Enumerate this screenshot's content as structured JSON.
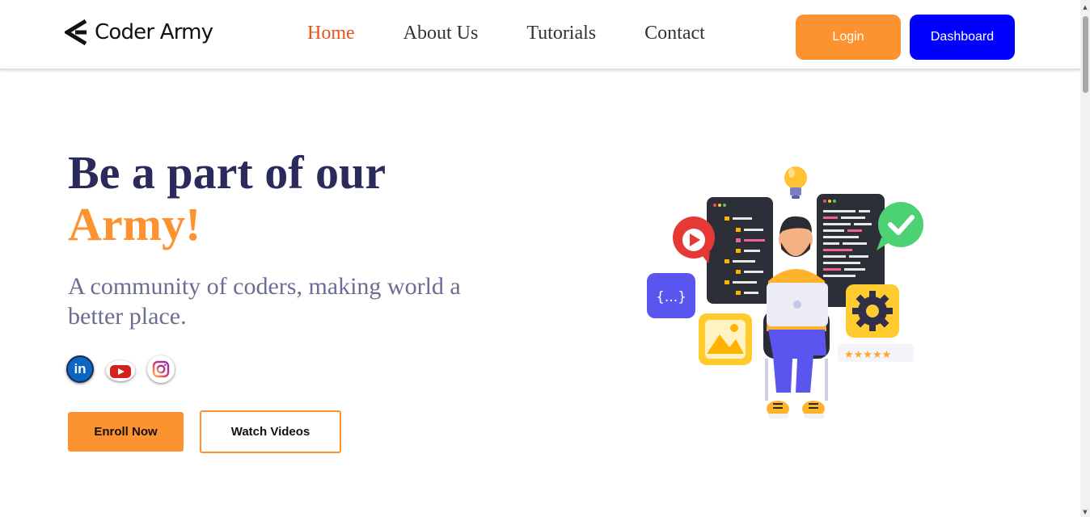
{
  "brand": {
    "name": "Coder Army",
    "icon": "coder-army-logo-icon"
  },
  "nav": {
    "items": [
      {
        "label": "Home",
        "active": true
      },
      {
        "label": "About Us",
        "active": false
      },
      {
        "label": "Tutorials",
        "active": false
      },
      {
        "label": "Contact",
        "active": false
      }
    ],
    "login_label": "Login",
    "dashboard_label": "Dashboard"
  },
  "hero": {
    "title_line1": "Be a part of our",
    "title_line2": "Army!",
    "subtitle": "A community of coders, making world a better place.",
    "socials": [
      "linkedin-icon",
      "youtube-icon",
      "instagram-icon"
    ],
    "linkedin_glyph": "in",
    "enroll_label": "Enroll Now",
    "watch_label": "Watch Videos",
    "illustration_code_badge": "{...}"
  },
  "colors": {
    "accent": "#fd9330",
    "nav_active": "#e8541d",
    "dashboard_button": "#0000ff",
    "title": "#2a2a5c",
    "subtitle": "#6b6d94"
  }
}
